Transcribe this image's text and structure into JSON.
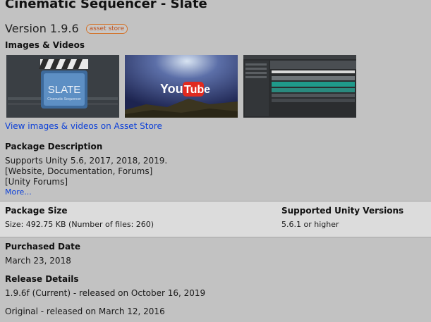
{
  "package": {
    "title": "Cinematic Sequencer - Slate",
    "version": "Version 1.9.6",
    "badge": "asset store"
  },
  "media": {
    "heading": "Images & Videos",
    "thumbnails": [
      {
        "icon": "slate-logo-image",
        "text": "SLATE",
        "subtext": "Cinematic Sequencer"
      },
      {
        "icon": "youtube-video-thumbnail",
        "text": "You",
        "subtext": "Tube"
      },
      {
        "icon": "editor-screenshot",
        "text": "",
        "subtext": ""
      }
    ],
    "link": "View images & videos on Asset Store"
  },
  "description": {
    "heading": "Package Description",
    "lines": [
      "Supports Unity 5.6, 2017, 2018, 2019.",
      "[Website, Documentation, Forums]",
      "[Unity Forums]"
    ],
    "more": "More..."
  },
  "size": {
    "heading": "Package Size",
    "value": "Size: 492.75 KB (Number of files: 260)",
    "versions_heading": "Supported Unity Versions",
    "versions_value": "5.6.1 or higher"
  },
  "purchased": {
    "heading": "Purchased Date",
    "value": "March 23, 2018"
  },
  "release": {
    "heading": "Release Details",
    "current": "1.9.6f (Current) - released on October 16,  2019",
    "original": "Original - released on March 12,  2016"
  },
  "colors": {
    "background": "#c2c2c2",
    "link": "#0b3fd8",
    "badge": "#c0501a",
    "band": "#dcdcdc"
  }
}
